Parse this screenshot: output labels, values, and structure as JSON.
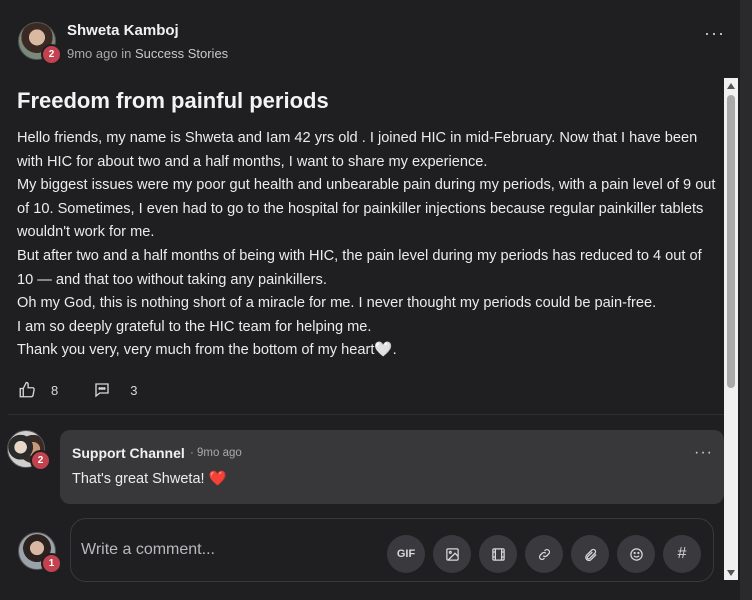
{
  "post": {
    "author": "Shweta Kamboj",
    "author_badge": "2",
    "time": "9mo ago",
    "in_word": "in",
    "category": "Success Stories",
    "more": "···",
    "title": "Freedom from painful periods",
    "paragraphs": [
      "Hello friends, my name is Shweta and Iam 42 yrs old . I joined HIC in mid-February. Now that I have been with HIC for about two and a half months, I want to share my experience.",
      "My biggest issues were my poor gut health and unbearable pain during my periods, with a pain level of 9 out of 10. Sometimes, I even had to go to the hospital for painkiller injections because regular painkiller tablets wouldn't work for me.",
      "But after two and a half months of being with HIC, the pain level during my periods has reduced to 4 out of 10 — and that too without taking any painkillers.",
      "Oh my God, this is nothing short of a miracle for me. I never thought my periods could be pain-free.",
      "I am so deeply grateful to the HIC team for helping me.",
      "Thank you very, very much from the bottom of my heart🤍."
    ],
    "likes": "8",
    "comments": "3"
  },
  "comment": {
    "author": "Support Channel",
    "badge": "2",
    "time": "· 9mo ago",
    "text": "That's great Shweta!",
    "emoji": "❤️",
    "more": "···"
  },
  "composer": {
    "badge": "1",
    "placeholder": "Write a comment...",
    "tools": [
      "GIF",
      "image",
      "video",
      "link",
      "attachment",
      "emoji",
      "#"
    ]
  },
  "colors": {
    "badge": "#c2424f",
    "background": "#1f1f21",
    "bubble": "#38383b"
  }
}
